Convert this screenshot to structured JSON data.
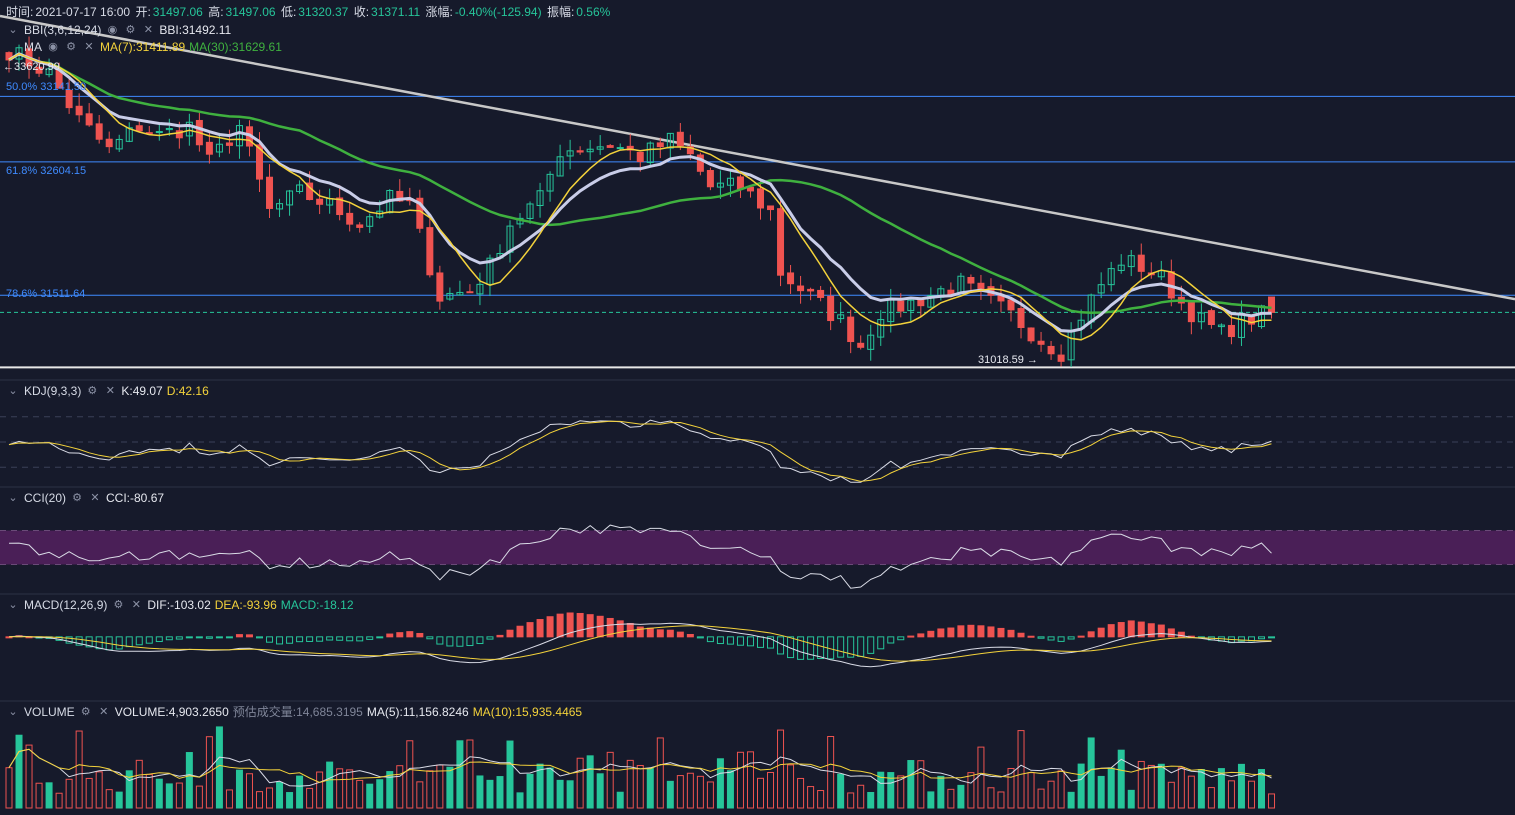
{
  "header": {
    "time_label": "时间:",
    "time": "2021-07-17 16:00",
    "open_label": "开:",
    "open": "31497.06",
    "high_label": "高:",
    "high": "31497.06",
    "low_label": "低:",
    "low": "31320.37",
    "close_label": "收:",
    "close": "31371.11",
    "change_label": "涨幅:",
    "change": "-0.40%(-125.94)",
    "amplitude_label": "振幅:",
    "amplitude": "0.56%"
  },
  "indicators": {
    "bbi": {
      "name": "BBI(3,6,12,24)",
      "value": "BBI:31492.11"
    },
    "ma": {
      "name": "MA",
      "ma7": "MA(7):31411.89",
      "ma30": "MA(30):31629.61"
    },
    "kdj": {
      "name": "KDJ(9,3,3)",
      "k": "K:49.07",
      "d": "D:42.16"
    },
    "cci": {
      "name": "CCI(20)",
      "value": "CCI:-80.67"
    },
    "macd": {
      "name": "MACD(12,26,9)",
      "dif": "DIF:-103.02",
      "dea": "DEA:-93.96",
      "macd": "MACD:-18.12"
    },
    "volume": {
      "name": "VOLUME",
      "value": "VOLUME:4,903.2650",
      "est_label": "预估成交量:",
      "est": "14,685.3195",
      "ma5": "MA(5):11,156.8246",
      "ma10": "MA(10):15,935.4465"
    }
  },
  "annotations": {
    "high_marker": "←33620.99",
    "fib50": "50.0% 33141.50",
    "fib618": "61.8% 32604.15",
    "fib786": "78.6% 31511.64",
    "low_marker": "31018.59 →"
  },
  "colors": {
    "background": "#161a2b",
    "up": "#26c59a",
    "down": "#ef5350",
    "ma7": "#f3d23b",
    "ma30": "#3fb13f",
    "bbi": "#c9cde8",
    "trendline": "#c8c8c8",
    "fib": "#3f8bff",
    "cci_band": "#4a1f57"
  },
  "chart_data": {
    "type": "candlestick",
    "price_range": [
      30850,
      33800
    ],
    "candle_count": 127,
    "last": {
      "time": "2021-07-17 16:00",
      "open": 31497.06,
      "high": 31497.06,
      "low": 31320.37,
      "close": 31371.11
    },
    "marked_high": 33620.99,
    "marked_low": 31018.59,
    "fibonacci": [
      {
        "level": "50.0%",
        "price": 33141.5
      },
      {
        "level": "61.8%",
        "price": 32604.15
      },
      {
        "level": "78.6%",
        "price": 31511.64
      }
    ],
    "close_anchors": [
      [
        0,
        33520
      ],
      [
        4,
        33330
      ],
      [
        7,
        32950
      ],
      [
        10,
        32700
      ],
      [
        13,
        32900
      ],
      [
        15,
        32820
      ],
      [
        18,
        32900
      ],
      [
        20,
        32600
      ],
      [
        23,
        32900
      ],
      [
        26,
        32200
      ],
      [
        29,
        32350
      ],
      [
        32,
        32250
      ],
      [
        35,
        32100
      ],
      [
        38,
        32300
      ],
      [
        40,
        32250
      ],
      [
        43,
        31500
      ],
      [
        46,
        31550
      ],
      [
        48,
        31750
      ],
      [
        50,
        32100
      ],
      [
        53,
        32300
      ],
      [
        55,
        32700
      ],
      [
        57,
        32720
      ],
      [
        60,
        32750
      ],
      [
        63,
        32650
      ],
      [
        66,
        32780
      ],
      [
        68,
        32650
      ],
      [
        70,
        32400
      ],
      [
        73,
        32400
      ],
      [
        76,
        32200
      ],
      [
        77,
        31700
      ],
      [
        80,
        31500
      ],
      [
        83,
        31300
      ],
      [
        85,
        31100
      ],
      [
        87,
        31380
      ],
      [
        90,
        31450
      ],
      [
        93,
        31550
      ],
      [
        95,
        31600
      ],
      [
        98,
        31450
      ],
      [
        100,
        31350
      ],
      [
        103,
        31150
      ],
      [
        105,
        31050
      ],
      [
        107,
        31350
      ],
      [
        109,
        31600
      ],
      [
        111,
        31800
      ],
      [
        113,
        31750
      ],
      [
        115,
        31650
      ],
      [
        117,
        31450
      ],
      [
        119,
        31300
      ],
      [
        121,
        31200
      ],
      [
        123,
        31300
      ],
      [
        125,
        31350
      ],
      [
        126,
        31371
      ]
    ],
    "kdj_range": [
      0,
      100
    ],
    "cci_range": [
      -250,
      250
    ],
    "macd_range": [
      -700,
      250
    ],
    "volume_range": [
      0,
      30000
    ]
  }
}
